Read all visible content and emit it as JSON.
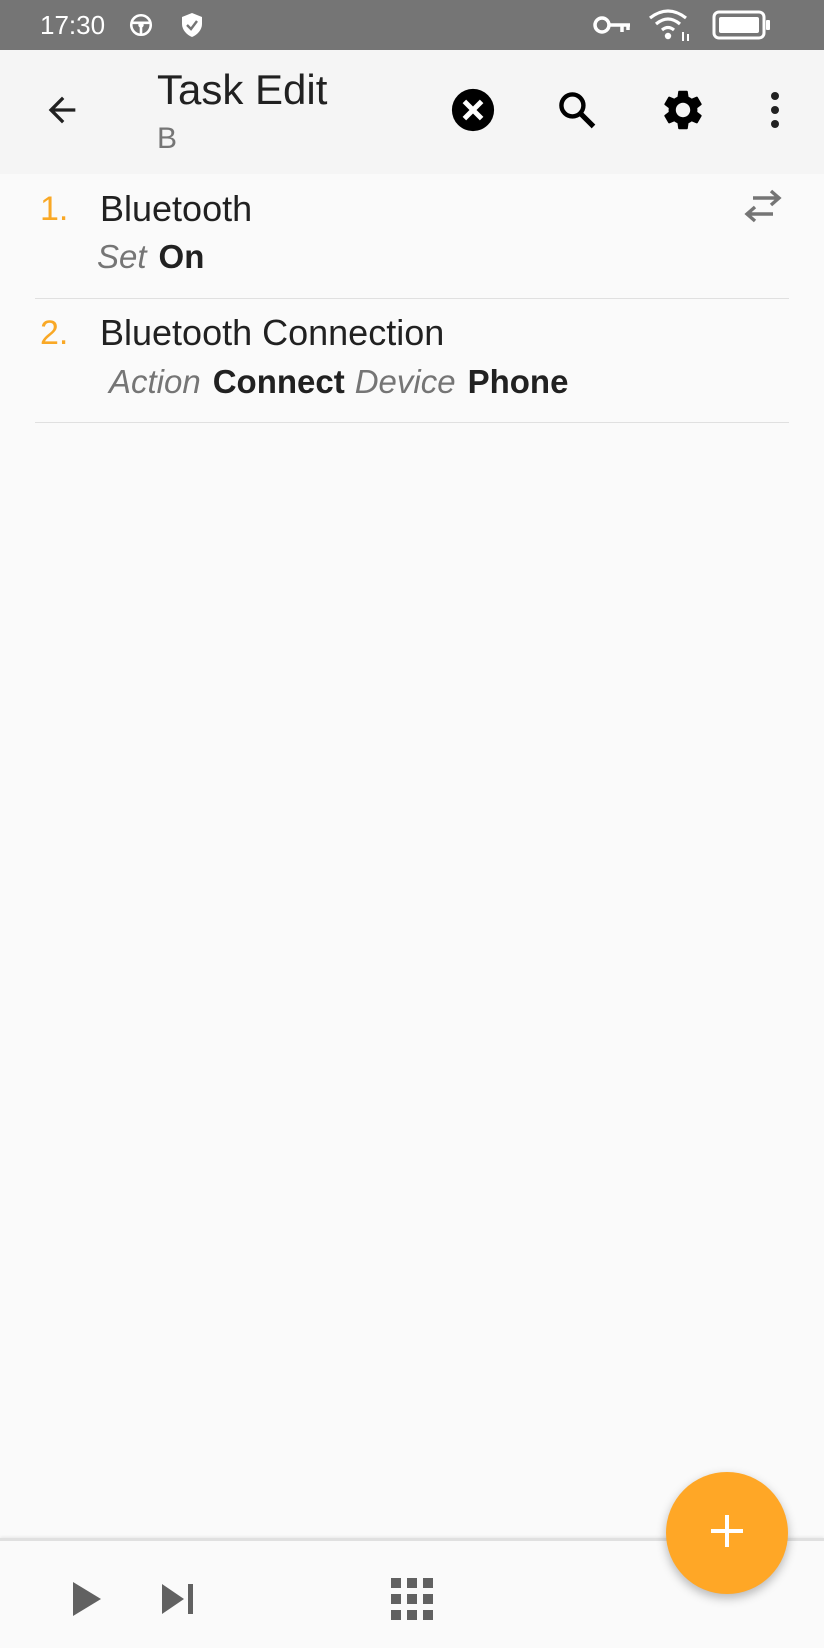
{
  "status_bar": {
    "time": "17:30",
    "icons": [
      "steering-wheel-icon",
      "shield-check-icon",
      "vpn-key-icon",
      "wifi-icon",
      "battery-icon"
    ]
  },
  "app_bar": {
    "title": "Task Edit",
    "subtitle": "B",
    "icons": [
      "arrow-back-icon",
      "close-circle-icon",
      "search-icon",
      "gear-icon",
      "more-vert-icon"
    ]
  },
  "actions": [
    {
      "number": "1.",
      "name": "Bluetooth",
      "params": [
        {
          "key": "Set",
          "value": "On"
        }
      ]
    },
    {
      "number": "2.",
      "name": "Bluetooth Connection",
      "params": [
        {
          "key": "Action",
          "value": "Connect"
        },
        {
          "key": "Device",
          "value": "Phone"
        }
      ]
    }
  ],
  "bottom_bar": {
    "icons": [
      "play-icon",
      "skip-next-icon",
      "grid-icon"
    ]
  },
  "fab": {
    "icon": "plus-icon"
  },
  "colors": {
    "status_bar": "#757575",
    "app_bar": "#f5f5f5",
    "accent": "#ffa726",
    "number": "#f9a825"
  }
}
